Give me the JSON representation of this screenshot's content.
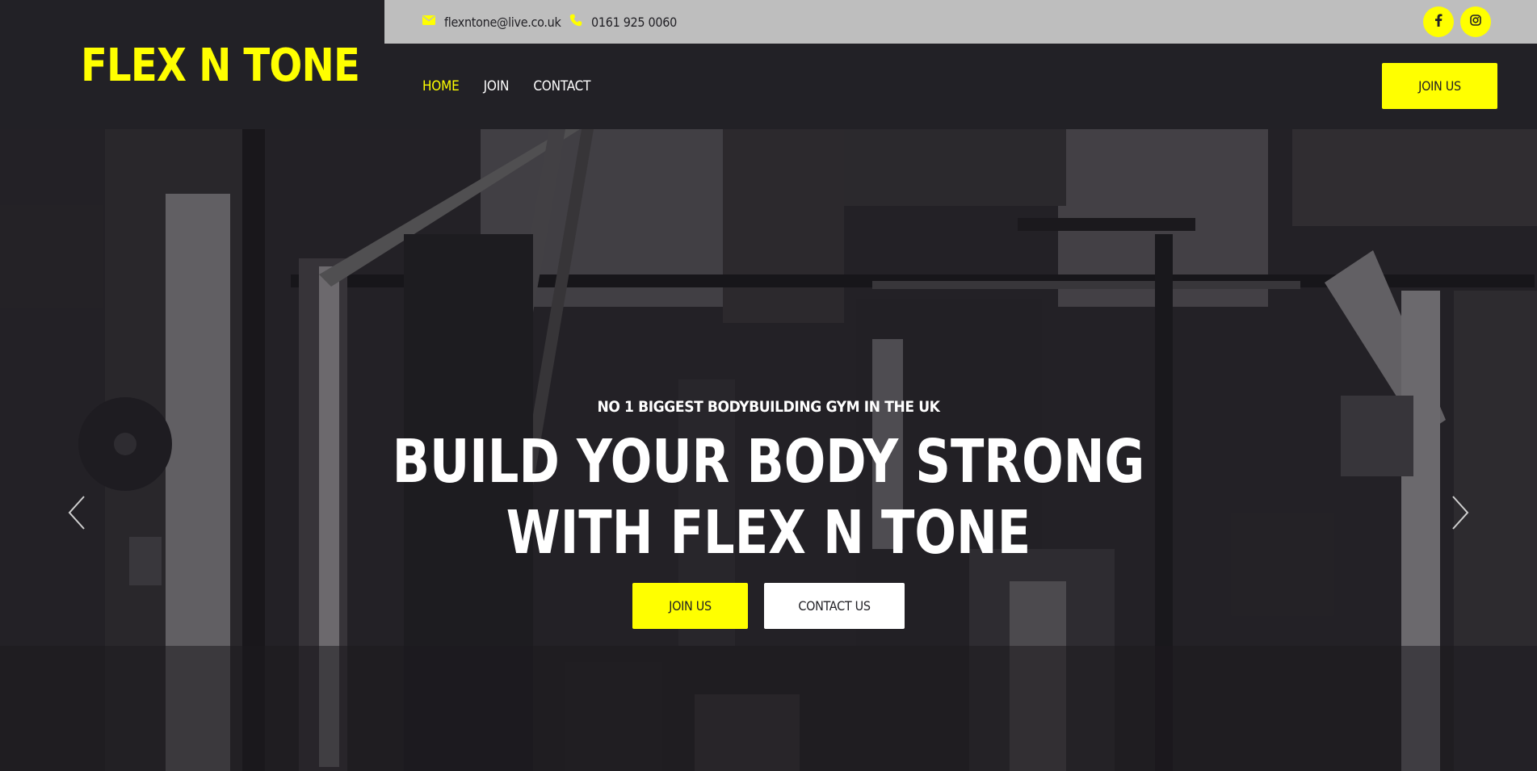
{
  "brand": {
    "logo_text": "FLEX N TONE",
    "accent_color": "#ffff00",
    "dark_color": "#222126"
  },
  "topbar": {
    "email": "flexntone@live.co.uk",
    "phone": "0161 925 0060",
    "email_icon": "envelope-icon",
    "phone_icon": "phone-icon",
    "social": [
      {
        "icon": "facebook-icon"
      },
      {
        "icon": "instagram-icon"
      }
    ]
  },
  "nav": {
    "items": [
      {
        "label": "HOME",
        "active": true
      },
      {
        "label": "JOIN",
        "active": false
      },
      {
        "label": "CONTACT",
        "active": false
      }
    ],
    "cta_label": "JOIN US"
  },
  "hero": {
    "eyebrow": "NO 1 BIGGEST BODYBUILDING GYM IN THE UK",
    "headline_line1": "BUILD YOUR BODY STRONG",
    "headline_line2": "WITH FLEX N TONE",
    "primary_button": "JOIN US",
    "secondary_button": "CONTACT US",
    "prev_icon": "chevron-left-icon",
    "next_icon": "chevron-right-icon"
  }
}
